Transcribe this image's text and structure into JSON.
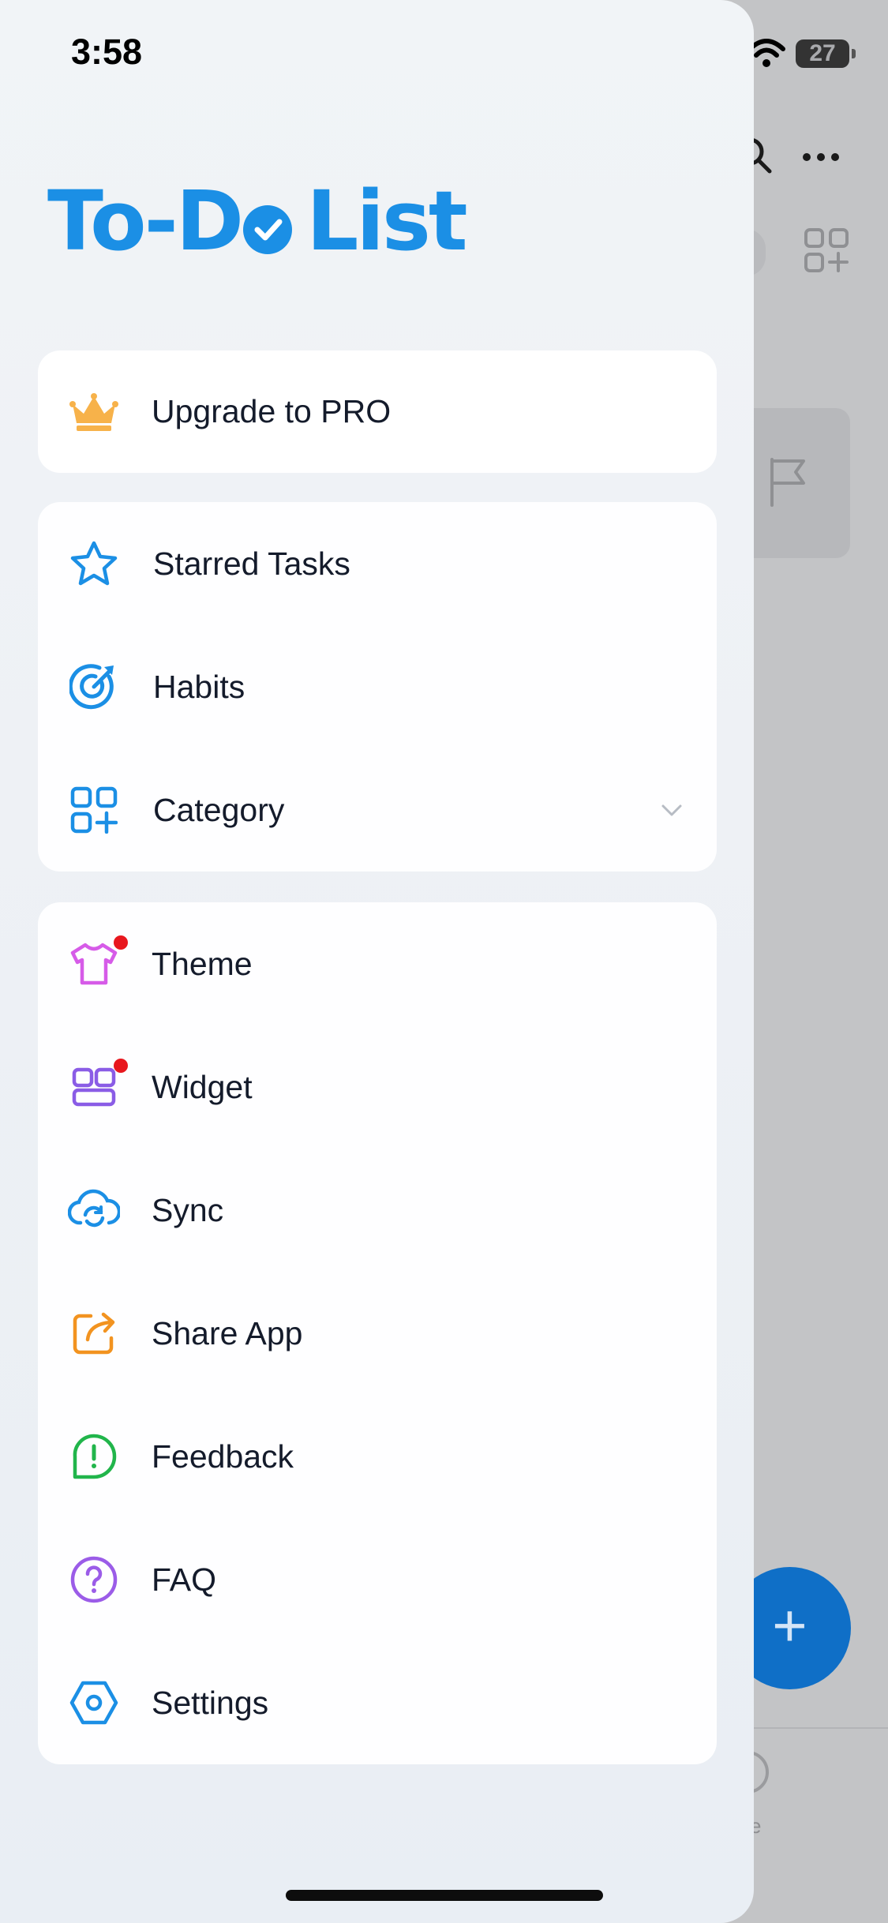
{
  "status_bar": {
    "time": "3:58",
    "battery": "27"
  },
  "background": {
    "fab_symbol": "+",
    "tab_partial_label": "e"
  },
  "drawer": {
    "app_title": {
      "part1": "To-D",
      "part2": "List"
    },
    "upgrade": {
      "label": "Upgrade to PRO",
      "icon": "crown-icon"
    },
    "main_items": [
      {
        "label": "Starred Tasks",
        "icon": "star-icon"
      },
      {
        "label": "Habits",
        "icon": "target-icon"
      },
      {
        "label": "Category",
        "icon": "category-grid-icon"
      }
    ],
    "more_items": [
      {
        "label": "Theme",
        "icon": "tshirt-icon",
        "badge": true
      },
      {
        "label": "Widget",
        "icon": "widget-icon",
        "badge": true
      },
      {
        "label": "Sync",
        "icon": "cloud-sync-icon"
      },
      {
        "label": "Share App",
        "icon": "share-icon"
      },
      {
        "label": "Feedback",
        "icon": "feedback-icon"
      },
      {
        "label": "FAQ",
        "icon": "question-icon"
      },
      {
        "label": "Settings",
        "icon": "settings-icon"
      }
    ]
  },
  "colors": {
    "brand_blue": "#1b8fe5",
    "badge_red": "#e8171e",
    "crown": "#f7b24a",
    "theme_pink": "#d65be8",
    "widget_purple": "#8a5ce6",
    "share_orange": "#f29320",
    "feedback_green": "#21b54b",
    "faq_purple": "#9b5ce8"
  }
}
